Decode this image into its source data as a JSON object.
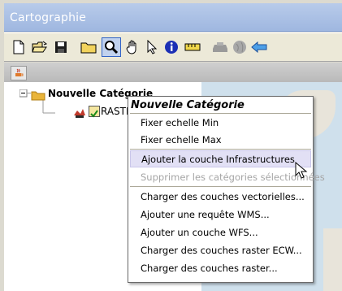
{
  "window": {
    "title": "Cartographie"
  },
  "toolbar": {
    "icons": [
      "new-file-icon",
      "open-file-icon",
      "save-icon",
      "folder-icon",
      "zoom-icon",
      "pan-hand-icon",
      "select-arrow-icon",
      "info-icon",
      "measure-ruler-icon",
      "layer-gray-icon",
      "globe-gray-icon",
      "back-arrow-icon"
    ],
    "active": "zoom-icon"
  },
  "tree": {
    "category_label": "Nouvelle Catégorie",
    "layer_label": "RASTE"
  },
  "context_menu": {
    "title": "Nouvelle Catégorie",
    "items": [
      {
        "label": "Fixer echelle Min"
      },
      {
        "label": "Fixer echelle Max"
      },
      {
        "label": "Ajouter la couche Infrastructures"
      },
      {
        "label": "Supprimer les catégories sélectionnées"
      },
      {
        "label": "Charger des couches vectorielles..."
      },
      {
        "label": "Ajouter une requête WMS..."
      },
      {
        "label": "Ajouter un couche WFS..."
      },
      {
        "label": "Charger des couches raster ECW..."
      },
      {
        "label": "Charger des couches raster..."
      }
    ],
    "highlighted_index": 2,
    "disabled_index": 3
  },
  "colors": {
    "titlebar": "#9fb7e0",
    "menu_hover": "#e2e0f5",
    "folder": "#e9b43a"
  }
}
